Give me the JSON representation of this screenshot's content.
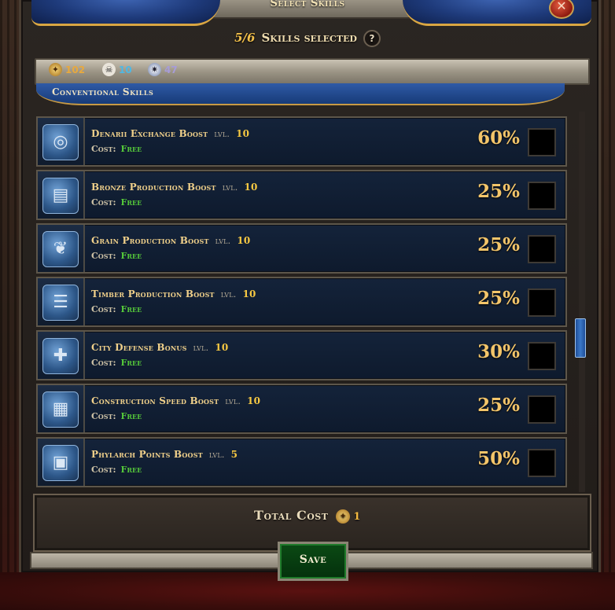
{
  "dialog": {
    "title": "Select Skills",
    "close_symbol": "✕"
  },
  "selection": {
    "count": "5/6",
    "label": "Skills selected",
    "help_symbol": "?"
  },
  "resources": {
    "gold": {
      "value": "102",
      "icon": "coin-icon"
    },
    "skull": {
      "value": "10",
      "icon": "skull-icon"
    },
    "gem": {
      "value": "47",
      "icon": "gem-icon"
    }
  },
  "section": {
    "title": "Conventional Skills"
  },
  "lvl_label": "lvl.",
  "cost_label": "Cost:",
  "skills": [
    {
      "name": "Denarii Exchange Boost",
      "level": "10",
      "cost": "Free",
      "percent": "60%",
      "icon": "denarii-icon",
      "glyph": "◎"
    },
    {
      "name": "Bronze Production Boost",
      "level": "10",
      "cost": "Free",
      "percent": "25%",
      "icon": "bronze-icon",
      "glyph": "▤"
    },
    {
      "name": "Grain Production Boost",
      "level": "10",
      "cost": "Free",
      "percent": "25%",
      "icon": "grain-icon",
      "glyph": "❦"
    },
    {
      "name": "Timber Production Boost",
      "level": "10",
      "cost": "Free",
      "percent": "25%",
      "icon": "timber-icon",
      "glyph": "☰"
    },
    {
      "name": "City Defense Bonus",
      "level": "10",
      "cost": "Free",
      "percent": "30%",
      "icon": "city-defense-icon",
      "glyph": "✚"
    },
    {
      "name": "Construction Speed Boost",
      "level": "10",
      "cost": "Free",
      "percent": "25%",
      "icon": "construction-icon",
      "glyph": "▦"
    },
    {
      "name": "Phylarch Points Boost",
      "level": "5",
      "cost": "Free",
      "percent": "50%",
      "icon": "phylarch-icon",
      "glyph": "▣"
    }
  ],
  "total": {
    "label": "Total Cost",
    "amount": "1",
    "icon": "coin-icon"
  },
  "save_button": {
    "label": "Save"
  }
}
